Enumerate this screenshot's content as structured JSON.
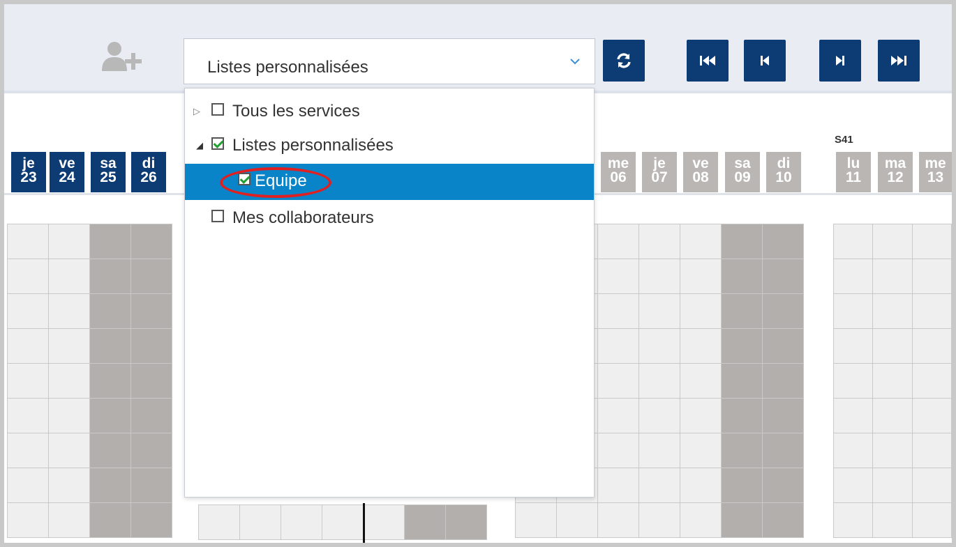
{
  "toolbar": {
    "list_select_value": "Listes personnalisées",
    "add_user_icon": "add-user-icon",
    "buttons": [
      "refresh-icon",
      "first-page-icon",
      "previous-page-icon",
      "next-page-icon",
      "last-page-icon"
    ]
  },
  "dropdown": {
    "items": [
      {
        "label": "Tous les services",
        "checked": false,
        "expander": "▷"
      },
      {
        "label": "Listes personnalisées",
        "checked": true,
        "expander": "◢"
      },
      {
        "label": "Equipe",
        "checked": true,
        "selected": true
      },
      {
        "label": "Mes collaborateurs",
        "checked": false
      }
    ]
  },
  "timeline": {
    "week_label": "S41",
    "days_left": [
      {
        "abbr": "je",
        "num": "23"
      },
      {
        "abbr": "ve",
        "num": "24"
      },
      {
        "abbr": "sa",
        "num": "25"
      },
      {
        "abbr": "di",
        "num": "26"
      }
    ],
    "days_mid": [
      {
        "abbr": "me",
        "num": "06"
      },
      {
        "abbr": "je",
        "num": "07"
      },
      {
        "abbr": "ve",
        "num": "08"
      },
      {
        "abbr": "sa",
        "num": "09"
      },
      {
        "abbr": "di",
        "num": "10"
      }
    ],
    "days_right": [
      {
        "abbr": "lu",
        "num": "11"
      },
      {
        "abbr": "ma",
        "num": "12"
      },
      {
        "abbr": "me",
        "num": "13"
      }
    ]
  },
  "colors": {
    "accent": "#0d3b74",
    "selection": "#0a84c8",
    "weekend": "#b2afad",
    "highlight": "#e02020"
  }
}
